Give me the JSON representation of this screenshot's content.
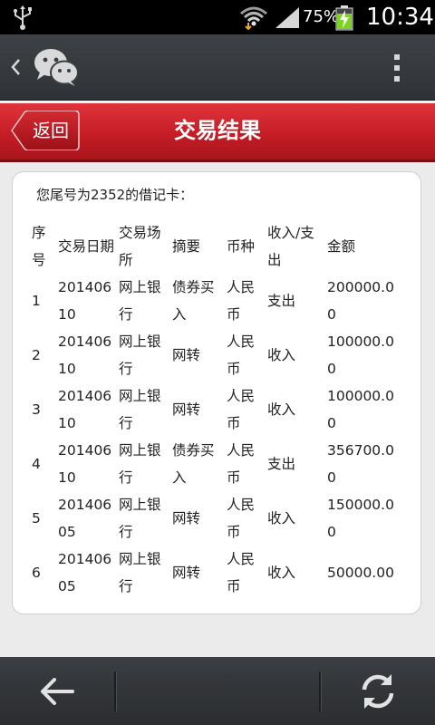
{
  "status_bar": {
    "battery_percent": "75%",
    "time": "10:34",
    "icons": [
      "usb-icon",
      "wifi-icon",
      "signal-icon",
      "battery-charging-icon"
    ]
  },
  "app_bar": {
    "icons": [
      "back-chevron-icon",
      "wechat-logo-icon",
      "overflow-menu-icon"
    ]
  },
  "header": {
    "back_label": "返回",
    "title": "交易结果"
  },
  "card": {
    "caption": "您尾号为2352的借记卡：",
    "columns": [
      "序号",
      "交易日期",
      "交易场所",
      "摘要",
      "币种",
      "收入/支出",
      "金额"
    ],
    "rows": [
      [
        "1",
        "20140610",
        "网上银行",
        "债券买入",
        "人民币",
        "支出",
        "200000.00"
      ],
      [
        "2",
        "20140610",
        "网上银行",
        "网转",
        "人民币",
        "收入",
        "100000.00"
      ],
      [
        "3",
        "20140610",
        "网上银行",
        "网转",
        "人民币",
        "收入",
        "100000.00"
      ],
      [
        "4",
        "20140610",
        "网上银行",
        "债券买入",
        "人民币",
        "支出",
        "356700.00"
      ],
      [
        "5",
        "20140605",
        "网上银行",
        "网转",
        "人民币",
        "收入",
        "150000.00"
      ],
      [
        "6",
        "20140605",
        "网上银行",
        "网转",
        "人民币",
        "收入",
        "50000.00"
      ]
    ]
  },
  "bottom_bar": {
    "icons": [
      "back-arrow-icon",
      "refresh-icon"
    ]
  },
  "colors": {
    "header_red": "#c51d26",
    "bar_dark": "#2f3236",
    "battery_green": "#7ed321"
  }
}
